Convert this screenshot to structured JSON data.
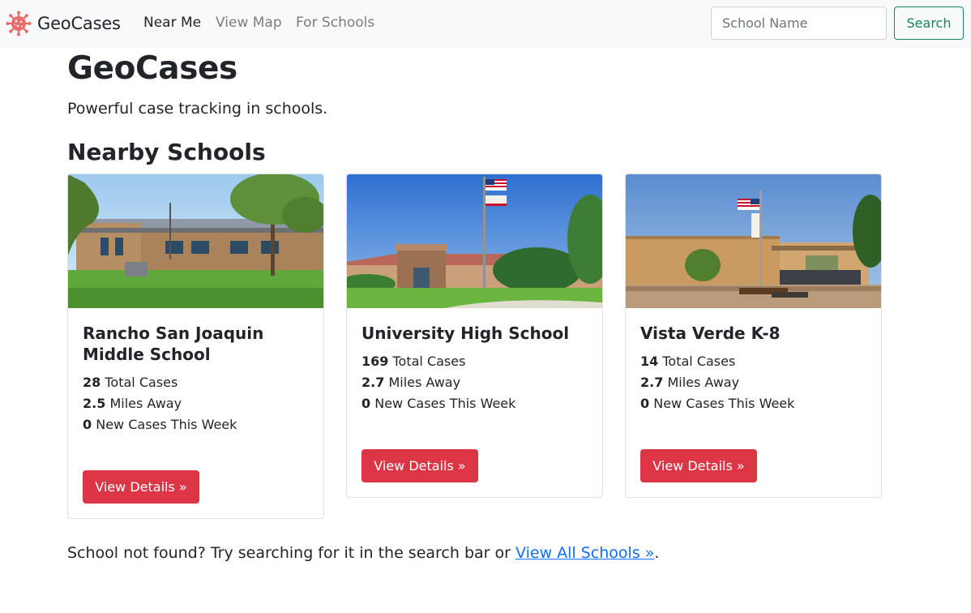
{
  "navbar": {
    "brand": "GeoCases",
    "links": [
      {
        "label": "Near Me"
      },
      {
        "label": "View Map"
      },
      {
        "label": "For Schools"
      }
    ],
    "search": {
      "placeholder": "School Name",
      "value": "",
      "button_label": "Search"
    }
  },
  "header": {
    "title": "GeoCases",
    "tagline": "Powerful case tracking in schools."
  },
  "section": {
    "title": "Nearby Schools"
  },
  "schools": [
    {
      "name": "Rancho San Joaquin Middle School",
      "total_cases": "28",
      "total_label": "Total Cases",
      "miles": "2.5",
      "miles_label": "Miles Away",
      "new_cases": "0",
      "new_label": "New Cases This Week",
      "button_label": "View Details »"
    },
    {
      "name": "University High School",
      "total_cases": "169",
      "total_label": "Total Cases",
      "miles": "2.7",
      "miles_label": "Miles Away",
      "new_cases": "0",
      "new_label": "New Cases This Week",
      "button_label": "View Details »"
    },
    {
      "name": "Vista Verde K-8",
      "total_cases": "14",
      "total_label": "Total Cases",
      "miles": "2.7",
      "miles_label": "Miles Away",
      "new_cases": "0",
      "new_label": "New Cases This Week",
      "button_label": "View Details »"
    }
  ],
  "footer": {
    "text": "School not found? Try searching for it in the search bar or",
    "link_label": "View All Schools »",
    "end": "."
  },
  "colors": {
    "navbar_bg": "#f8f9fa",
    "danger": "#dc3545",
    "success": "#198754",
    "link": "#0d6efd",
    "brand_icon": "#e86a6a"
  },
  "icons": {
    "brand": "virus-icon"
  }
}
